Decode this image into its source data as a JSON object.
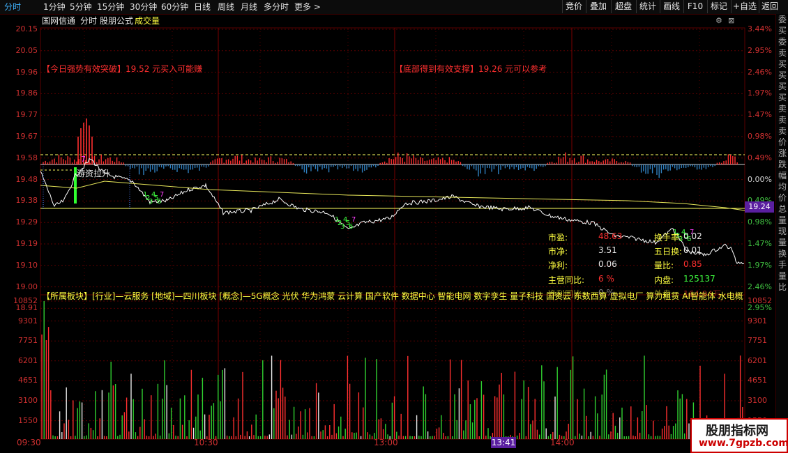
{
  "tabs": [
    "分时",
    "1分钟",
    "5分钟",
    "15分钟",
    "30分钟",
    "60分钟",
    "日线",
    "周线",
    "月线",
    "多分时",
    "更多 >"
  ],
  "active_tab": "分时",
  "toolbar": [
    "竞价",
    "叠加",
    "超盘",
    "统计",
    "画线",
    "F10",
    "标记",
    "+自选",
    "返回"
  ],
  "caption": {
    "stock": "国网信通",
    "mode": "分时",
    "formula": "股朋公式",
    "indicator": "成交量"
  },
  "price_axis_left": [
    "20.15",
    "20.05",
    "19.96",
    "19.86",
    "19.77",
    "19.67",
    "19.58",
    "19.48",
    "19.38",
    "19.29",
    "19.19",
    "19.10",
    "19.00",
    "18.91"
  ],
  "price_axis_right": [
    "3.44%",
    "2.95%",
    "2.46%",
    "1.97%",
    "1.47%",
    "0.98%",
    "0.49%",
    "0.00%",
    "0.49%",
    "0.98%",
    "1.47%",
    "1.97%",
    "2.46%",
    "2.95%"
  ],
  "vol_axis": [
    "10852",
    "9301",
    "7751",
    "6201",
    "4651",
    "3100",
    "1550"
  ],
  "vol_axis_right": [
    "10852",
    "9301",
    "7751",
    "6201",
    "4651",
    "3100",
    "1550"
  ],
  "notes": {
    "left": "【今日强势有效突破】19.52 元买入可能赚",
    "right": "【底部得到有效支撑】19.26 元可以参考"
  },
  "signal_label": "游资拉升",
  "info": {
    "k1": "市盈:",
    "v1": "48.63",
    "k2": "换手率:",
    "v2": "0.02",
    "k3": "市净:",
    "v3": "3.51",
    "k4": "五日换:",
    "v4": "0.01",
    "k5": "净利:",
    "v5": "0.06",
    "k6": "量比:",
    "v6": "0.85",
    "k7": "主营同比:",
    "v7": "6 %",
    "k8": "内盘:",
    "v8": "125137",
    "k9": "净利同比:",
    "v9": "0 %",
    "k10": "外盘:",
    "v10": "164.94万"
  },
  "sector_text": "【所属板块】[行业]—云服务 [地域]—四川板块 [概念]—5G概念 光伏 华为鸿蒙 云计算 国产软件 数据中心 智能电网 数字孪生 量子科技 国资云 东数西算 虚拟电厂 算力租赁 AI智能体 水电概",
  "time_labels": [
    "09:30",
    "10:30",
    "13:00",
    "14:00"
  ],
  "current_time": "13:41",
  "current_price": "19.24",
  "markers": [
    "1",
    "2",
    "3",
    "4",
    "5",
    "6",
    "7",
    "8",
    "9"
  ],
  "right_strip_text": "委买委卖买买买买卖卖卖价涨跌幅均价总量现量换手量比",
  "watermark": {
    "line1": "股朋指标网",
    "line2": "www.7gpzb.com"
  },
  "colors": {
    "up": "#ff3030",
    "down": "#40ff40",
    "price_line": "#ffffff",
    "avg_line": "#e8e85a",
    "grid": "#5a0000",
    "accent": "#5a1fa0"
  }
}
